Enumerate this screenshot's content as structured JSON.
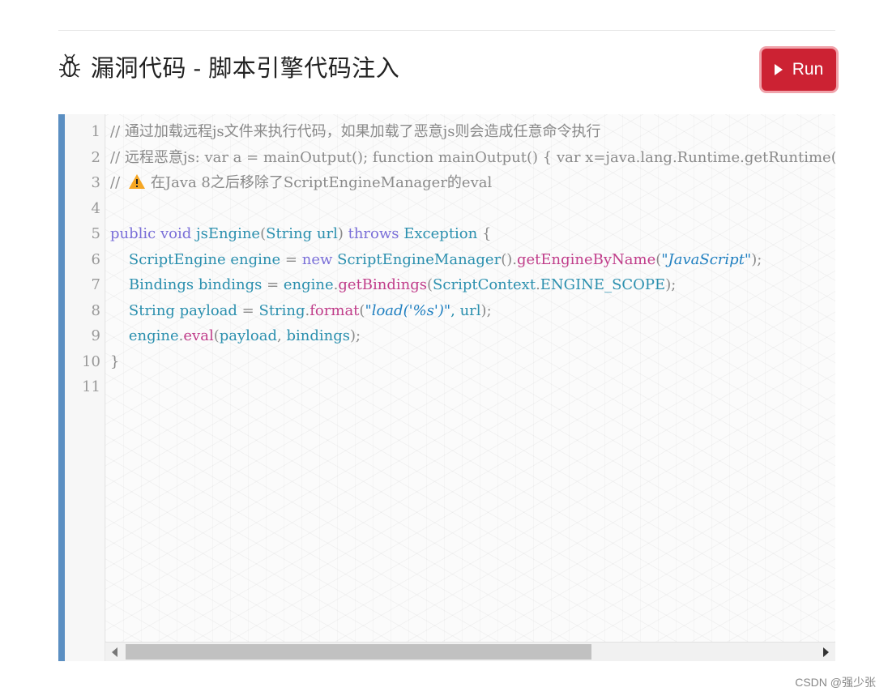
{
  "header": {
    "title": "漏洞代码 - 脚本引擎代码注入",
    "icon": "bug-icon",
    "run_label": "Run",
    "run_icon": "play-icon"
  },
  "editor": {
    "line_numbers": [
      "1",
      "2",
      "3",
      "4",
      "5",
      "6",
      "7",
      "8",
      "9",
      "10",
      "11"
    ],
    "lines": [
      [
        {
          "t": "// 通过加载远程js文件来执行代码，如果加载了恶意js则会造成任意命令执行",
          "c": "cm"
        }
      ],
      [
        {
          "t": "// 远程恶意js: var a = mainOutput(); function mainOutput() { var x=java.lang.Runtime.getRuntime().exec(\"open -a Calculator\");}",
          "c": "cm"
        }
      ],
      [
        {
          "t": "// ",
          "c": "cm"
        },
        {
          "icon": "warning-icon"
        },
        {
          "t": "在Java 8之后移除了ScriptEngineManager的eval",
          "c": "cm"
        }
      ],
      [],
      [
        {
          "t": "public",
          "c": "kw"
        },
        {
          "t": " ",
          "c": ""
        },
        {
          "t": "void",
          "c": "kw"
        },
        {
          "t": " ",
          "c": ""
        },
        {
          "t": "jsEngine",
          "c": "id"
        },
        {
          "t": "(",
          "c": "pn"
        },
        {
          "t": "String",
          "c": "ty"
        },
        {
          "t": " url",
          "c": "id"
        },
        {
          "t": ")",
          "c": "pn"
        },
        {
          "t": " ",
          "c": ""
        },
        {
          "t": "throws",
          "c": "kw"
        },
        {
          "t": " ",
          "c": ""
        },
        {
          "t": "Exception",
          "c": "ty"
        },
        {
          "t": " {",
          "c": "pn"
        }
      ],
      [
        {
          "t": "    ",
          "c": ""
        },
        {
          "t": "ScriptEngine",
          "c": "ty"
        },
        {
          "t": " engine ",
          "c": "id"
        },
        {
          "t": "=",
          "c": "pn"
        },
        {
          "t": " ",
          "c": ""
        },
        {
          "t": "new",
          "c": "kw"
        },
        {
          "t": " ",
          "c": ""
        },
        {
          "t": "ScriptEngineManager",
          "c": "ty"
        },
        {
          "t": "().",
          "c": "pn"
        },
        {
          "t": "getEngineByName",
          "c": "fn"
        },
        {
          "t": "(",
          "c": "pn"
        },
        {
          "t": "\"JavaScript\"",
          "c": "st"
        },
        {
          "t": ");",
          "c": "pn"
        }
      ],
      [
        {
          "t": "    ",
          "c": ""
        },
        {
          "t": "Bindings",
          "c": "ty"
        },
        {
          "t": " bindings ",
          "c": "id"
        },
        {
          "t": "=",
          "c": "pn"
        },
        {
          "t": " engine",
          "c": "id"
        },
        {
          "t": ".",
          "c": "pn"
        },
        {
          "t": "getBindings",
          "c": "fn"
        },
        {
          "t": "(",
          "c": "pn"
        },
        {
          "t": "ScriptContext",
          "c": "ty"
        },
        {
          "t": ".",
          "c": "pn"
        },
        {
          "t": "ENGINE_SCOPE",
          "c": "id"
        },
        {
          "t": ");",
          "c": "pn"
        }
      ],
      [
        {
          "t": "    ",
          "c": ""
        },
        {
          "t": "String",
          "c": "ty"
        },
        {
          "t": " payload ",
          "c": "id"
        },
        {
          "t": "=",
          "c": "pn"
        },
        {
          "t": " ",
          "c": ""
        },
        {
          "t": "String",
          "c": "ty"
        },
        {
          "t": ".",
          "c": "pn"
        },
        {
          "t": "format",
          "c": "fn"
        },
        {
          "t": "(",
          "c": "pn"
        },
        {
          "t": "\"load('%s')\"",
          "c": "st"
        },
        {
          "t": ", url",
          "c": "id"
        },
        {
          "t": ");",
          "c": "pn"
        }
      ],
      [
        {
          "t": "    ",
          "c": ""
        },
        {
          "t": "engine",
          "c": "id"
        },
        {
          "t": ".",
          "c": "pn"
        },
        {
          "t": "eval",
          "c": "fn"
        },
        {
          "t": "(",
          "c": "pn"
        },
        {
          "t": "payload",
          "c": "id"
        },
        {
          "t": ", ",
          "c": "pn"
        },
        {
          "t": "bindings",
          "c": "id"
        },
        {
          "t": ");",
          "c": "pn"
        }
      ],
      [
        {
          "t": "}",
          "c": "pn"
        }
      ],
      []
    ]
  },
  "watermark": "CSDN @强少张"
}
